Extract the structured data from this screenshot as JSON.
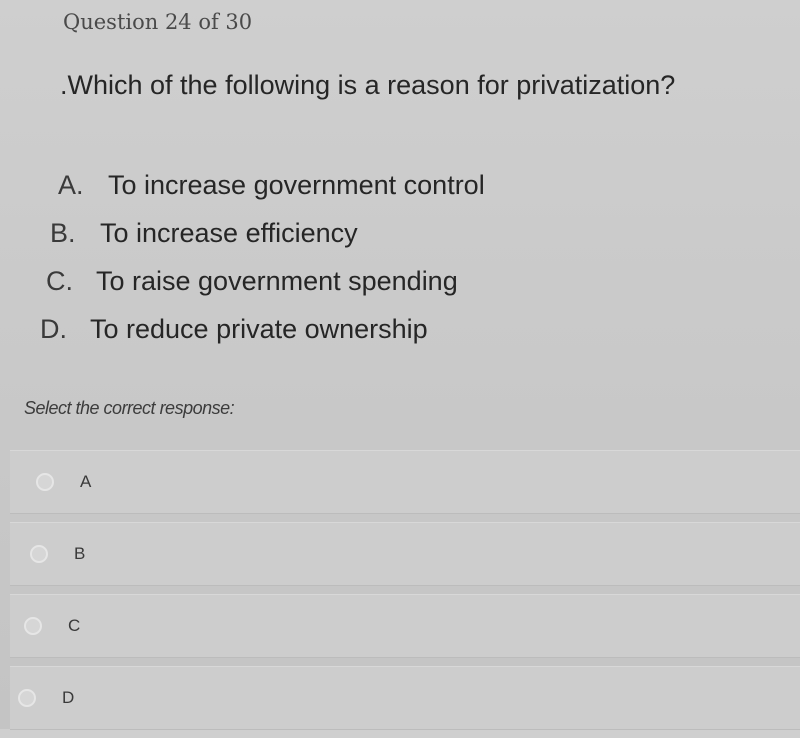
{
  "header": {
    "progress": "Question 24 of 30"
  },
  "question": {
    "text": ".Which of the following is a reason for privatization?"
  },
  "choices": [
    {
      "letter": "A.",
      "text": "To increase government control"
    },
    {
      "letter": "B.",
      "text": "To increase efficiency"
    },
    {
      "letter": "C.",
      "text": "To raise government spending"
    },
    {
      "letter": "D.",
      "text": "To reduce private ownership"
    }
  ],
  "instruction": "Select the correct response:",
  "options": [
    {
      "label": "A",
      "selected": false
    },
    {
      "label": "B",
      "selected": false
    },
    {
      "label": "C",
      "selected": false
    },
    {
      "label": "D",
      "selected": false
    }
  ]
}
